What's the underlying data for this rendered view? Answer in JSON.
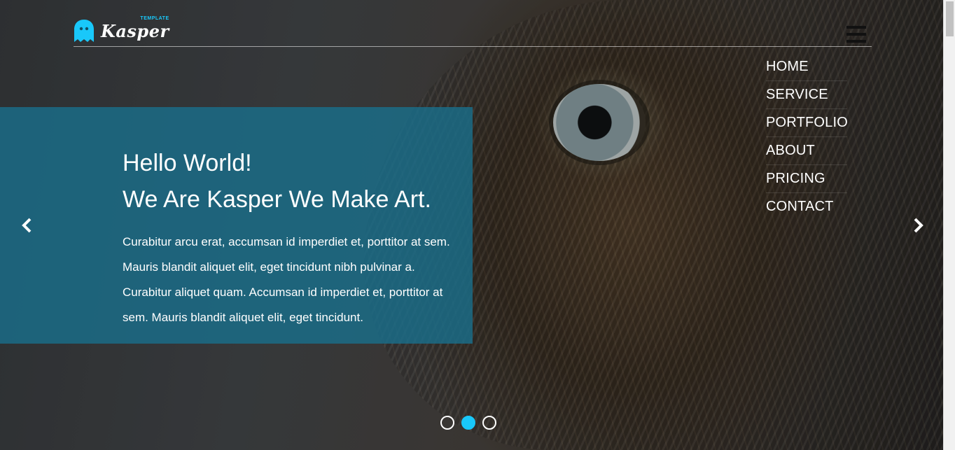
{
  "brand": {
    "name": "Kasper",
    "tag": "TEMPLATE",
    "accent_color": "#19c8fa",
    "icon": "ghost-icon"
  },
  "header": {
    "menu_icon": "hamburger-icon"
  },
  "nav": {
    "items": [
      {
        "label": "HOME"
      },
      {
        "label": "SERVICE"
      },
      {
        "label": "PORTFOLIO"
      },
      {
        "label": "ABOUT"
      },
      {
        "label": "PRICING"
      },
      {
        "label": "CONTACT"
      }
    ]
  },
  "slider": {
    "heading_line1": "Hello World!",
    "heading_line2": "We Are Kasper We Make Art.",
    "text_lines": [
      "Curabitur arcu erat, accumsan id imperdiet et, porttitor at sem.",
      "Mauris blandit aliquet elit, eget tincidunt nibh pulvinar a.",
      "Curabitur aliquet quam. Accumsan id imperdiet et, porttitor at",
      "sem. Mauris blandit aliquet elit, eget tincidunt."
    ],
    "prev_icon": "chevron-left-icon",
    "next_icon": "chevron-right-icon",
    "slide_count": 3,
    "active_slide": 2,
    "box_color": "#1a6e8a"
  }
}
